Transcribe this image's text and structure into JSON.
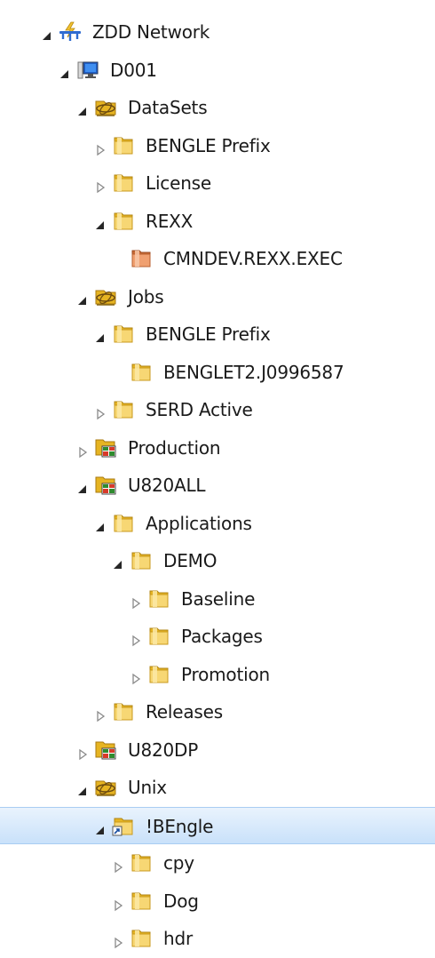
{
  "tree": [
    {
      "label": "ZDD Network",
      "level": 0,
      "toggle": "expanded",
      "icon": "network-icon"
    },
    {
      "label": "D001",
      "level": 1,
      "toggle": "expanded",
      "icon": "computer-icon"
    },
    {
      "label": "DataSets",
      "level": 2,
      "toggle": "expanded",
      "icon": "dataset-group-icon"
    },
    {
      "label": "BENGLE Prefix",
      "level": 3,
      "toggle": "collapsed",
      "icon": "folder-icon"
    },
    {
      "label": "License",
      "level": 3,
      "toggle": "collapsed",
      "icon": "folder-icon"
    },
    {
      "label": "REXX",
      "level": 3,
      "toggle": "expanded",
      "icon": "folder-icon"
    },
    {
      "label": "CMNDEV.REXX.EXEC",
      "level": 4,
      "toggle": "none",
      "icon": "dataset-folder-icon"
    },
    {
      "label": "Jobs",
      "level": 2,
      "toggle": "expanded",
      "icon": "dataset-group-icon"
    },
    {
      "label": "BENGLE Prefix",
      "level": 3,
      "toggle": "expanded",
      "icon": "folder-icon"
    },
    {
      "label": "BENGLET2.J0996587",
      "level": 4,
      "toggle": "none",
      "icon": "folder-icon"
    },
    {
      "label": "SERD Active",
      "level": 3,
      "toggle": "collapsed",
      "icon": "folder-icon"
    },
    {
      "label": "Production",
      "level": 2,
      "toggle": "collapsed",
      "icon": "project-icon"
    },
    {
      "label": "U820ALL",
      "level": 2,
      "toggle": "expanded",
      "icon": "project-icon"
    },
    {
      "label": "Applications",
      "level": 3,
      "toggle": "expanded",
      "icon": "folder-icon"
    },
    {
      "label": "DEMO",
      "level": 4,
      "toggle": "expanded",
      "icon": "folder-icon"
    },
    {
      "label": "Baseline",
      "level": 5,
      "toggle": "collapsed",
      "icon": "folder-icon"
    },
    {
      "label": "Packages",
      "level": 5,
      "toggle": "collapsed",
      "icon": "folder-icon"
    },
    {
      "label": "Promotion",
      "level": 5,
      "toggle": "collapsed",
      "icon": "folder-icon"
    },
    {
      "label": "Releases",
      "level": 3,
      "toggle": "collapsed",
      "icon": "folder-icon"
    },
    {
      "label": "U820DP",
      "level": 2,
      "toggle": "collapsed",
      "icon": "project-icon"
    },
    {
      "label": "Unix",
      "level": 2,
      "toggle": "expanded",
      "icon": "dataset-group-icon"
    },
    {
      "label": "!BEngle",
      "level": 3,
      "toggle": "expanded",
      "icon": "folder-shortcut-icon",
      "selected": true
    },
    {
      "label": "cpy",
      "level": 4,
      "toggle": "collapsed",
      "icon": "folder-icon"
    },
    {
      "label": "Dog",
      "level": 4,
      "toggle": "collapsed",
      "icon": "folder-icon"
    },
    {
      "label": "hdr",
      "level": 4,
      "toggle": "collapsed",
      "icon": "folder-icon"
    }
  ],
  "colors": {
    "selection": "#cce4fb",
    "folder": "#f2c94c",
    "dataset_folder": "#e38a55"
  }
}
